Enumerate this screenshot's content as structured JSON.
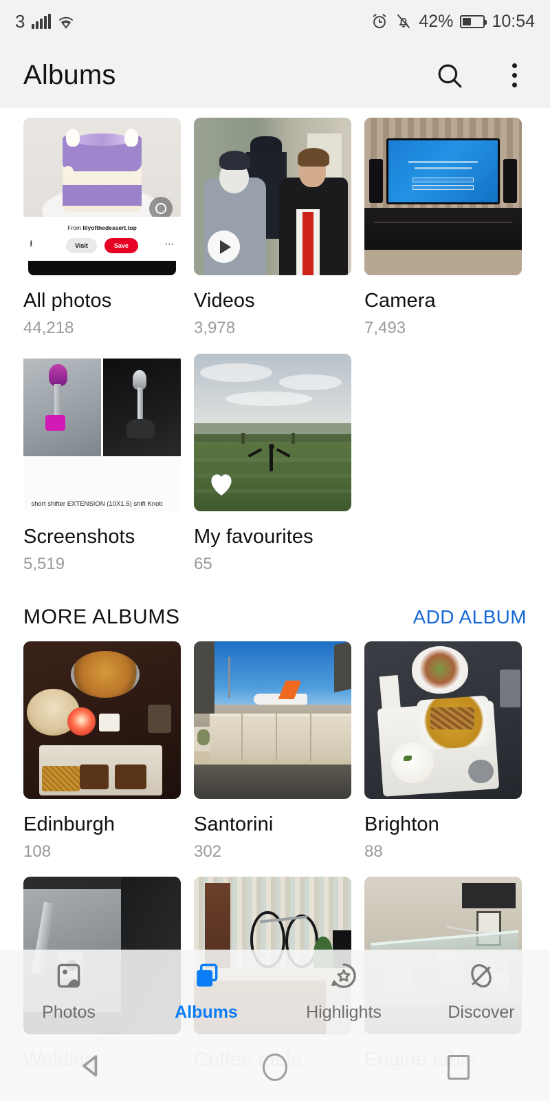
{
  "status_bar": {
    "carrier": "3",
    "signal_icon": "signal-bars-icon",
    "wifi_icon": "wifi-icon",
    "alarm_icon": "alarm-clock-icon",
    "silent_icon": "bell-off-icon",
    "battery_percent": "42%",
    "battery_level": 42,
    "clock": "10:54"
  },
  "app_bar": {
    "title": "Albums",
    "search_icon": "search-icon",
    "overflow_icon": "more-vertical-icon"
  },
  "albums": {
    "system": [
      {
        "name": "All photos",
        "count": "44,218",
        "badge": "none"
      },
      {
        "name": "Videos",
        "count": "3,978",
        "badge": "play"
      },
      {
        "name": "Camera",
        "count": "7,493",
        "badge": "none"
      },
      {
        "name": "Screenshots",
        "count": "5,519",
        "badge": "none"
      },
      {
        "name": "My favourites",
        "count": "65",
        "badge": "heart"
      }
    ]
  },
  "more_albums_section": {
    "title": "MORE ALBUMS",
    "action_label": "ADD ALBUM",
    "action_color": "#1668d6",
    "items": [
      {
        "name": "Edinburgh",
        "count": "108"
      },
      {
        "name": "Santorini",
        "count": "302"
      },
      {
        "name": "Brighton",
        "count": "88"
      },
      {
        "name": "Welding",
        "count": ""
      },
      {
        "name": "Coffee table",
        "count": ""
      },
      {
        "name": "Engine table",
        "count": ""
      }
    ]
  },
  "thumbnail_content": {
    "all_photos": {
      "description": "Pinterest screenshot of purple drip cake",
      "from_prefix": "From ",
      "source": "lilyofthedessert.top",
      "visit_label": "Visit",
      "save_label": "Save",
      "save_color": "#e60023",
      "lens_icon": "visual-search-icon",
      "share_icon": "share-icon",
      "more_icon": "more-horizontal-icon"
    },
    "screenshots": {
      "caption": "short shifter EXTENSION (10X1.5) shift Knob"
    }
  },
  "bottom_nav": {
    "active": "Albums",
    "active_color": "#0a7cf5",
    "items": [
      {
        "label": "Photos",
        "icon": "photo-icon"
      },
      {
        "label": "Albums",
        "icon": "albums-stack-icon"
      },
      {
        "label": "Highlights",
        "icon": "star-circle-icon"
      },
      {
        "label": "Discover",
        "icon": "discover-globe-icon"
      }
    ]
  },
  "system_nav": {
    "back_icon": "triangle-back-icon",
    "home_icon": "circle-home-icon",
    "recents_icon": "square-recents-icon"
  }
}
